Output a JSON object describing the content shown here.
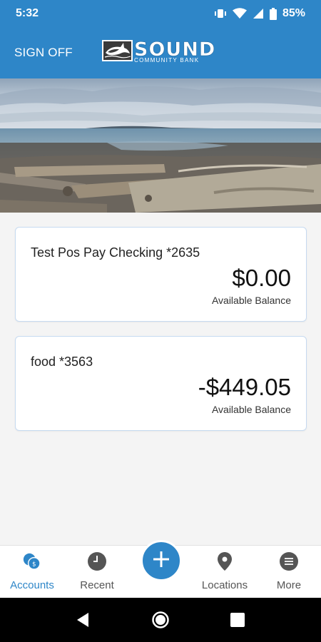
{
  "status_bar": {
    "time": "5:32",
    "battery": "85%",
    "icons": [
      "vibrate-icon",
      "wifi-icon",
      "signal-icon",
      "battery-icon"
    ]
  },
  "header": {
    "sign_off": "SIGN OFF",
    "logo_word": "SOUND",
    "logo_sub": "COMMUNITY BANK"
  },
  "accounts": [
    {
      "name": "Test Pos Pay Checking *2635",
      "amount": "$0.00",
      "label": "Available Balance"
    },
    {
      "name": "food *3563",
      "amount": "-$449.05",
      "label": "Available Balance"
    }
  ],
  "bottom_nav": {
    "accounts": "Accounts",
    "recent": "Recent",
    "locations": "Locations",
    "more": "More"
  },
  "colors": {
    "primary": "#2e86c8",
    "card_border": "#c6daf0",
    "background": "#f4f4f4"
  }
}
